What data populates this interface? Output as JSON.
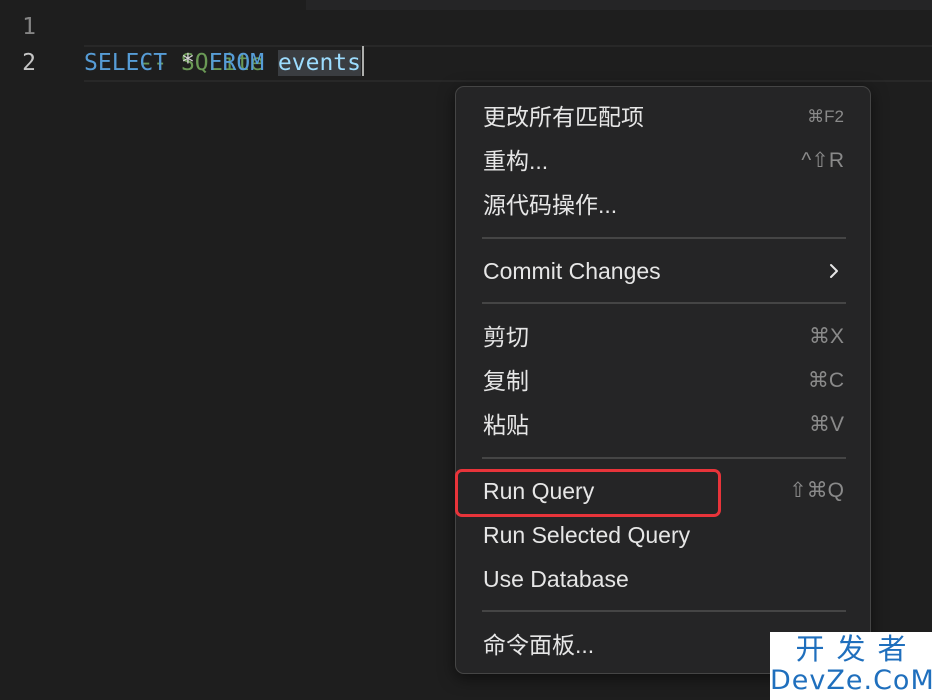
{
  "editor": {
    "line_numbers": [
      "1",
      "2"
    ],
    "line1": {
      "comment": "-- SQLite"
    },
    "line2": {
      "keyword_select": "SELECT",
      "operator": "*",
      "keyword_from": "FROM",
      "identifier": "events"
    }
  },
  "context_menu": {
    "groups": [
      {
        "items": [
          {
            "label": "更改所有匹配项",
            "shortcut": "⌘F2"
          },
          {
            "label": "重构...",
            "shortcut": "^⇧R"
          },
          {
            "label": "源代码操作...",
            "shortcut": ""
          }
        ]
      },
      {
        "items": [
          {
            "label": "Commit Changes",
            "shortcut": "",
            "submenu": true
          }
        ]
      },
      {
        "items": [
          {
            "label": "剪切",
            "shortcut": "⌘X"
          },
          {
            "label": "复制",
            "shortcut": "⌘C"
          },
          {
            "label": "粘贴",
            "shortcut": "⌘V"
          }
        ]
      },
      {
        "items": [
          {
            "label": "Run Query",
            "shortcut": "⇧⌘Q",
            "highlighted": true
          },
          {
            "label": "Run Selected Query",
            "shortcut": ""
          },
          {
            "label": "Use Database",
            "shortcut": ""
          }
        ]
      },
      {
        "items": [
          {
            "label": "命令面板...",
            "shortcut": ""
          }
        ]
      }
    ]
  },
  "watermark": {
    "line1": "开发者",
    "line2": "DevZe.CoM"
  },
  "colors": {
    "background": "#1e1e1e",
    "menu_background": "#252526",
    "comment": "#6a9955",
    "keyword": "#569cd6",
    "identifier": "#9cdcfe",
    "highlight_border": "#e8343a",
    "watermark_text": "#1f6fbd"
  },
  "icons": {
    "submenu": "chevron-right-icon"
  }
}
